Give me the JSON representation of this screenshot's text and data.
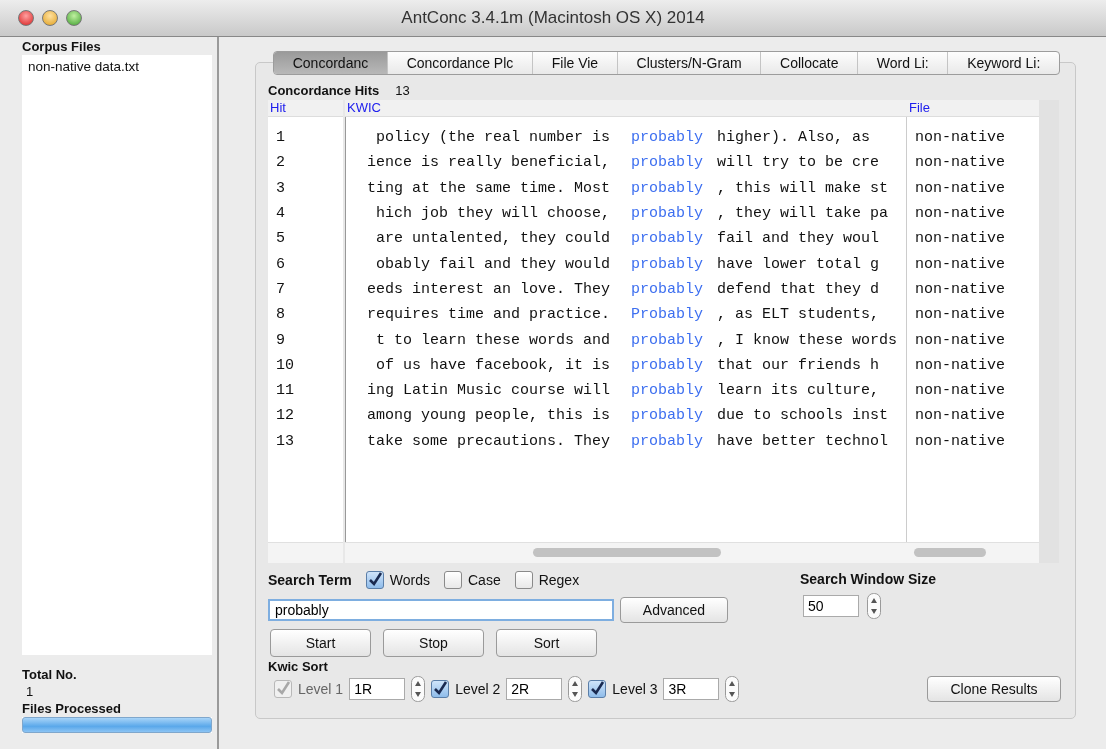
{
  "window": {
    "title": "AntConc 3.4.1m (Macintosh OS X) 2014"
  },
  "corpus_files": {
    "title": "Corpus Files",
    "items": [
      "non-native data.txt"
    ]
  },
  "total": {
    "label": "Total No.",
    "value": "1"
  },
  "files_processed": {
    "label": "Files Processed",
    "level": 1
  },
  "tabs": [
    {
      "label": "Concordanc",
      "selected": true
    },
    {
      "label": "Concordance Plc",
      "selected": false
    },
    {
      "label": "File Vie",
      "selected": false
    },
    {
      "label": "Clusters/N-Gram",
      "selected": false
    },
    {
      "label": "Collocate",
      "selected": false
    },
    {
      "label": "Word Li:",
      "selected": false
    },
    {
      "label": "Keyword Li:",
      "selected": false
    }
  ],
  "hits": {
    "label": "Concordance Hits",
    "value": "13"
  },
  "table": {
    "columns": [
      "Hit",
      "KWIC",
      "File"
    ],
    "rows": [
      {
        "hit": "1",
        "left": "policy (the real number is",
        "key": "probably",
        "right": "higher). Also, as",
        "file": "non-native"
      },
      {
        "hit": "2",
        "left": "ience is really beneficial,",
        "key": "probably",
        "right": "will try to be cre",
        "file": "non-native"
      },
      {
        "hit": "3",
        "left": "ting at the same time. Most",
        "key": "probably",
        "right": ", this will make st",
        "file": "non-native"
      },
      {
        "hit": "4",
        "left": "hich job they will choose,",
        "key": "probably",
        "right": ", they will take pa",
        "file": "non-native"
      },
      {
        "hit": "5",
        "left": "are untalented, they could",
        "key": "probably",
        "right": "fail and they woul",
        "file": "non-native"
      },
      {
        "hit": "6",
        "left": "obably fail and they would",
        "key": "probably",
        "right": "have lower total g",
        "file": "non-native"
      },
      {
        "hit": "7",
        "left": "eeds interest an love. They",
        "key": "probably",
        "right": "defend that they d",
        "file": "non-native"
      },
      {
        "hit": "8",
        "left": "requires time and practice.",
        "key": "Probably",
        "right": ", as ELT students,",
        "file": "non-native"
      },
      {
        "hit": "9",
        "left": "t to learn these words and",
        "key": "probably",
        "right": ", I know these words",
        "file": "non-native"
      },
      {
        "hit": "10",
        "left": "of us have facebook, it is",
        "key": "probably",
        "right": "that our friends h",
        "file": "non-native"
      },
      {
        "hit": "11",
        "left": "ing Latin Music course will",
        "key": "probably",
        "right": "learn its culture,",
        "file": "non-native"
      },
      {
        "hit": "12",
        "left": "among young people, this is",
        "key": "probably",
        "right": "due to schools inst",
        "file": "non-native"
      },
      {
        "hit": "13",
        "left": "take some precautions. They",
        "key": "probably",
        "right": "have better technol",
        "file": "non-native"
      }
    ]
  },
  "search": {
    "label": "Search Term",
    "options": [
      {
        "label": "Words",
        "checked": true
      },
      {
        "label": "Case",
        "checked": false
      },
      {
        "label": "Regex",
        "checked": false
      }
    ],
    "value": "probably",
    "advanced": "Advanced"
  },
  "buttons": [
    "Start",
    "Stop",
    "Sort"
  ],
  "window_size": {
    "label": "Search Window Size",
    "value": "50"
  },
  "kwic_sort": {
    "label": "Kwic Sort",
    "levels": [
      {
        "label": "Level 1",
        "checked": true,
        "disabled": true,
        "value": "1R"
      },
      {
        "label": "Level 2",
        "checked": true,
        "disabled": false,
        "value": "2R"
      },
      {
        "label": "Level 3",
        "checked": true,
        "disabled": false,
        "value": "3R"
      }
    ]
  },
  "clone": "Clone Results"
}
